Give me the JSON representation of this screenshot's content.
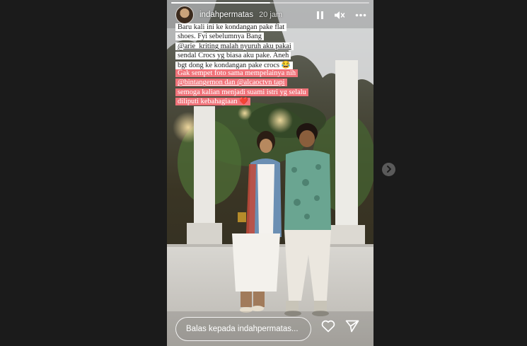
{
  "story": {
    "username": "indahpermatas",
    "time_ago": "20 jam",
    "progress_fraction": 0.5
  },
  "caption_top": {
    "lines": [
      "Baru kali ini ke kondangan pake flat",
      "shoes. Fyi sebelumnya Bang",
      "@arie_kriting malah nyuruh aku pakai",
      "sendal Crocs yg biasa aku pake. Aneh",
      "bgt dong ke kondangan pake crocs 😂"
    ]
  },
  "caption_bottom": {
    "lines": [
      "Gak sempet foto sama mempelainya nih",
      "@bintangemon dan @alcaoctvn tapi",
      "semoga kalian menjadi suami istri yg selalu",
      "diliputi kebahagiaan ❤️"
    ]
  },
  "reply": {
    "placeholder": "Balas kepada indahpermatas..."
  },
  "icons": {
    "pause": "pause-icon",
    "mute": "mute-icon",
    "more": "more-icon",
    "like": "heart-icon",
    "send": "send-icon",
    "next": "chevron-right-icon"
  }
}
